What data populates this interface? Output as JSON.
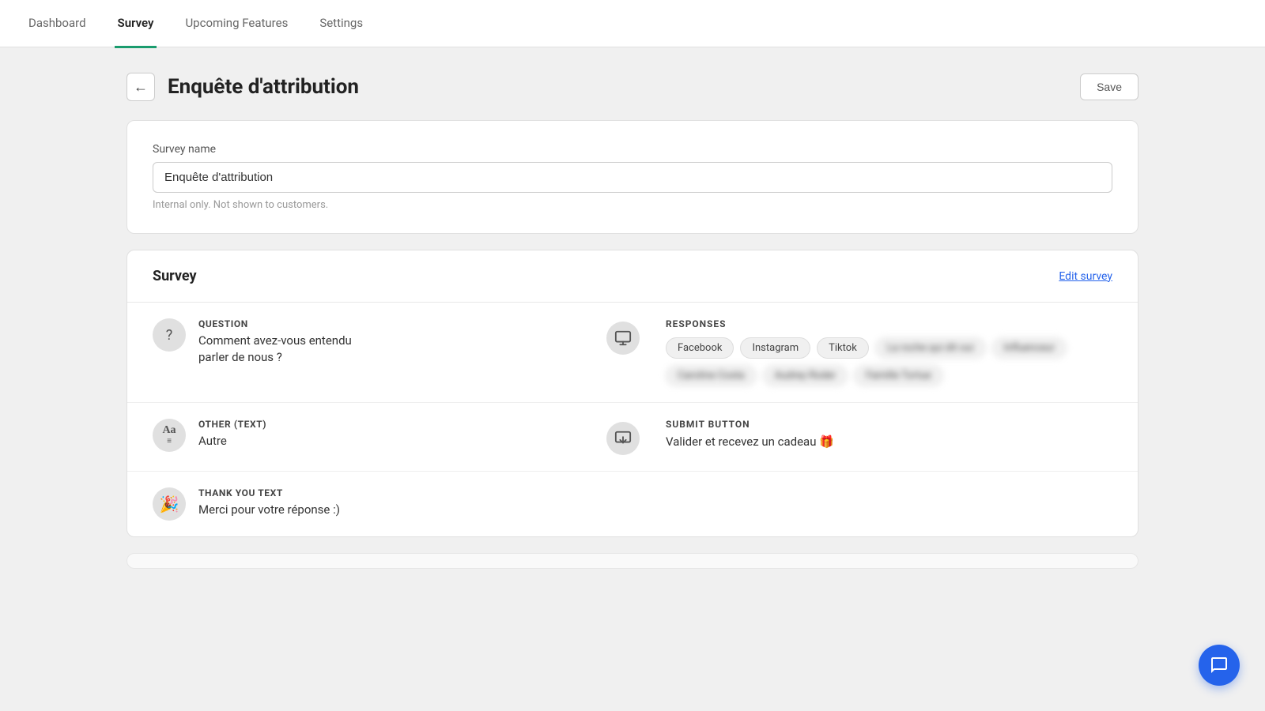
{
  "nav": {
    "tabs": [
      {
        "id": "dashboard",
        "label": "Dashboard",
        "active": false
      },
      {
        "id": "survey",
        "label": "Survey",
        "active": true
      },
      {
        "id": "upcoming",
        "label": "Upcoming Features",
        "active": false
      },
      {
        "id": "settings",
        "label": "Settings",
        "active": false
      }
    ]
  },
  "page": {
    "title": "Enquête d'attribution",
    "back_label": "←",
    "save_label": "Save"
  },
  "name_card": {
    "field_label": "Survey name",
    "field_value": "Enquête d'attribution",
    "field_hint": "Internal only. Not shown to customers."
  },
  "survey_card": {
    "title": "Survey",
    "edit_label": "Edit survey",
    "rows": [
      {
        "id": "question",
        "type_label": "QUESTION",
        "value": "Comment avez-vous entendu\nparler de nous ?",
        "has_responses": true,
        "responses_label": "RESPONSES",
        "chips": [
          {
            "label": "Facebook",
            "blurred": false
          },
          {
            "label": "Instagram",
            "blurred": false
          },
          {
            "label": "Tiktok",
            "blurred": false
          },
          {
            "label": "La roche qui dit oui",
            "blurred": true
          },
          {
            "label": "Influenceur",
            "blurred": true
          },
          {
            "label": "Caroline Costa",
            "blurred": true
          },
          {
            "label": "Audrey Roder",
            "blurred": true
          },
          {
            "label": "Famille Tortue",
            "blurred": true
          }
        ]
      },
      {
        "id": "other-text",
        "type_label": "OTHER (TEXT)",
        "value": "Autre",
        "has_submit": true,
        "submit_label": "SUBMIT BUTTON",
        "submit_value": "Valider et recevez un cadeau 🎁"
      },
      {
        "id": "thank-you",
        "type_label": "THANK YOU TEXT",
        "value": "Merci pour votre réponse :)",
        "has_nothing": true
      }
    ]
  },
  "icons": {
    "question": "?",
    "other_text": "Aa",
    "thank_you": "🎉",
    "responses_icon": "📊",
    "submit_icon": "⬇"
  }
}
